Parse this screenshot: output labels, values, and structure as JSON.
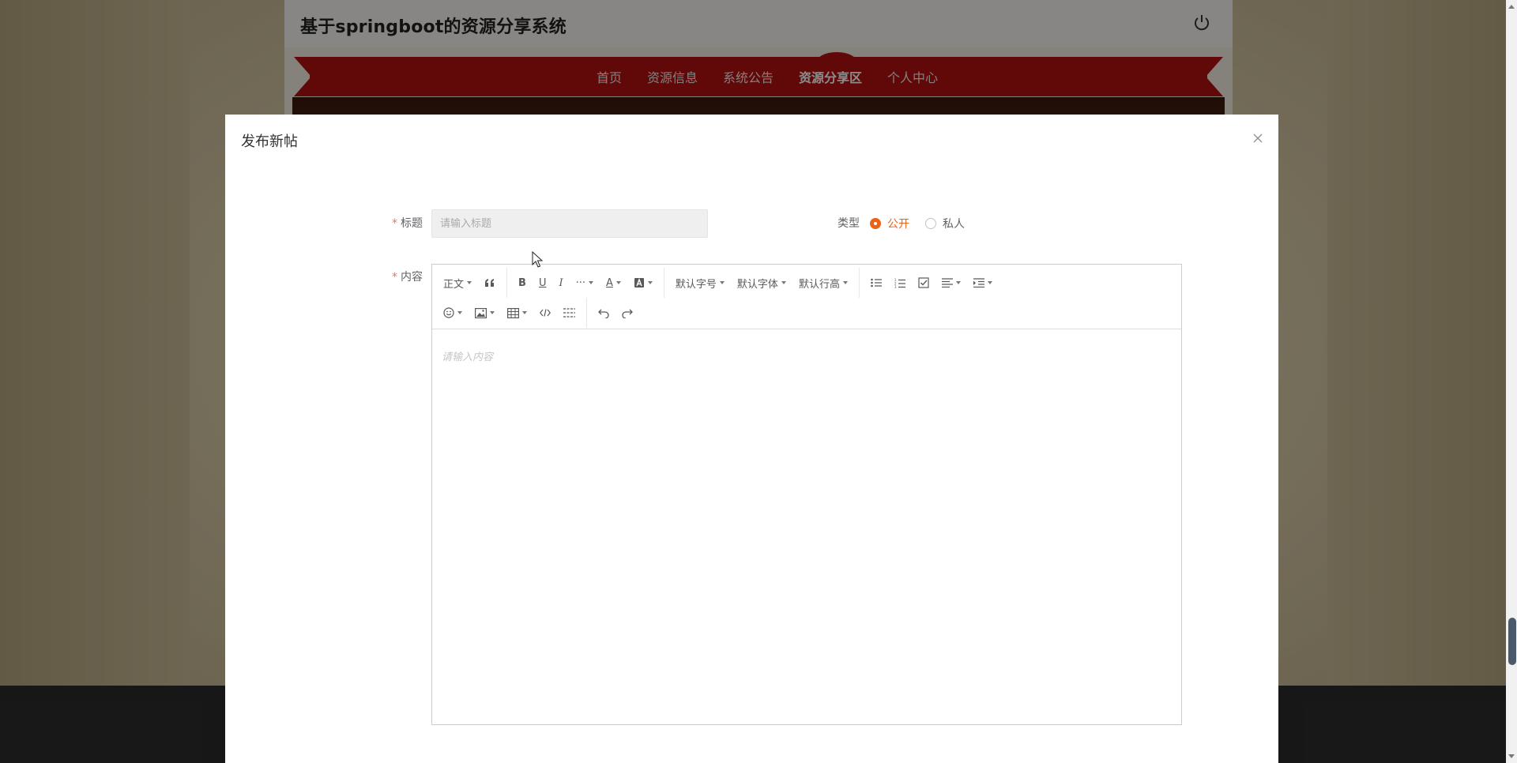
{
  "site": {
    "title": "基于springboot的资源分享系统",
    "nav": [
      {
        "label": "首页",
        "active": false
      },
      {
        "label": "资源信息",
        "active": false
      },
      {
        "label": "系统公告",
        "active": false
      },
      {
        "label": "资源分享区",
        "active": true
      },
      {
        "label": "个人中心",
        "active": false
      }
    ]
  },
  "dialog": {
    "title": "发布新帖",
    "form": {
      "title_label": "标题",
      "title_placeholder": "请输入标题",
      "title_value": "",
      "type_label": "类型",
      "type_options": [
        {
          "label": "公开",
          "checked": true
        },
        {
          "label": "私人",
          "checked": false
        }
      ],
      "content_label": "内容",
      "content_placeholder": "请输入内容"
    },
    "toolbar": {
      "heading": "正文",
      "font_size": "默认字号",
      "font_family": "默认字体",
      "line_height": "默认行高"
    }
  },
  "colors": {
    "accent": "#e8641b",
    "nav_red": "#b0120f",
    "required": "#f56c6c"
  }
}
